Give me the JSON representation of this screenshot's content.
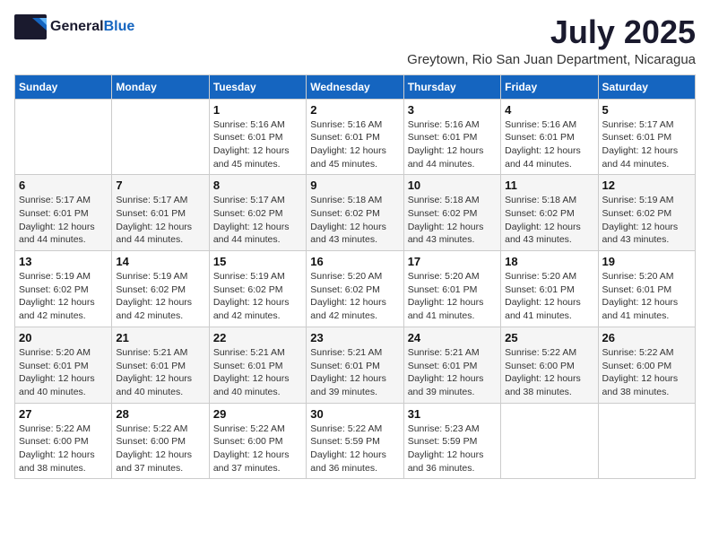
{
  "logo": {
    "general": "General",
    "blue": "Blue"
  },
  "title": {
    "month": "July 2025",
    "subtitle": "Greytown, Rio San Juan Department, Nicaragua"
  },
  "calendar": {
    "headers": [
      "Sunday",
      "Monday",
      "Tuesday",
      "Wednesday",
      "Thursday",
      "Friday",
      "Saturday"
    ],
    "weeks": [
      [
        {
          "day": "",
          "info": ""
        },
        {
          "day": "",
          "info": ""
        },
        {
          "day": "1",
          "info": "Sunrise: 5:16 AM\nSunset: 6:01 PM\nDaylight: 12 hours and 45 minutes."
        },
        {
          "day": "2",
          "info": "Sunrise: 5:16 AM\nSunset: 6:01 PM\nDaylight: 12 hours and 45 minutes."
        },
        {
          "day": "3",
          "info": "Sunrise: 5:16 AM\nSunset: 6:01 PM\nDaylight: 12 hours and 44 minutes."
        },
        {
          "day": "4",
          "info": "Sunrise: 5:16 AM\nSunset: 6:01 PM\nDaylight: 12 hours and 44 minutes."
        },
        {
          "day": "5",
          "info": "Sunrise: 5:17 AM\nSunset: 6:01 PM\nDaylight: 12 hours and 44 minutes."
        }
      ],
      [
        {
          "day": "6",
          "info": "Sunrise: 5:17 AM\nSunset: 6:01 PM\nDaylight: 12 hours and 44 minutes."
        },
        {
          "day": "7",
          "info": "Sunrise: 5:17 AM\nSunset: 6:01 PM\nDaylight: 12 hours and 44 minutes."
        },
        {
          "day": "8",
          "info": "Sunrise: 5:17 AM\nSunset: 6:02 PM\nDaylight: 12 hours and 44 minutes."
        },
        {
          "day": "9",
          "info": "Sunrise: 5:18 AM\nSunset: 6:02 PM\nDaylight: 12 hours and 43 minutes."
        },
        {
          "day": "10",
          "info": "Sunrise: 5:18 AM\nSunset: 6:02 PM\nDaylight: 12 hours and 43 minutes."
        },
        {
          "day": "11",
          "info": "Sunrise: 5:18 AM\nSunset: 6:02 PM\nDaylight: 12 hours and 43 minutes."
        },
        {
          "day": "12",
          "info": "Sunrise: 5:19 AM\nSunset: 6:02 PM\nDaylight: 12 hours and 43 minutes."
        }
      ],
      [
        {
          "day": "13",
          "info": "Sunrise: 5:19 AM\nSunset: 6:02 PM\nDaylight: 12 hours and 42 minutes."
        },
        {
          "day": "14",
          "info": "Sunrise: 5:19 AM\nSunset: 6:02 PM\nDaylight: 12 hours and 42 minutes."
        },
        {
          "day": "15",
          "info": "Sunrise: 5:19 AM\nSunset: 6:02 PM\nDaylight: 12 hours and 42 minutes."
        },
        {
          "day": "16",
          "info": "Sunrise: 5:20 AM\nSunset: 6:02 PM\nDaylight: 12 hours and 42 minutes."
        },
        {
          "day": "17",
          "info": "Sunrise: 5:20 AM\nSunset: 6:01 PM\nDaylight: 12 hours and 41 minutes."
        },
        {
          "day": "18",
          "info": "Sunrise: 5:20 AM\nSunset: 6:01 PM\nDaylight: 12 hours and 41 minutes."
        },
        {
          "day": "19",
          "info": "Sunrise: 5:20 AM\nSunset: 6:01 PM\nDaylight: 12 hours and 41 minutes."
        }
      ],
      [
        {
          "day": "20",
          "info": "Sunrise: 5:20 AM\nSunset: 6:01 PM\nDaylight: 12 hours and 40 minutes."
        },
        {
          "day": "21",
          "info": "Sunrise: 5:21 AM\nSunset: 6:01 PM\nDaylight: 12 hours and 40 minutes."
        },
        {
          "day": "22",
          "info": "Sunrise: 5:21 AM\nSunset: 6:01 PM\nDaylight: 12 hours and 40 minutes."
        },
        {
          "day": "23",
          "info": "Sunrise: 5:21 AM\nSunset: 6:01 PM\nDaylight: 12 hours and 39 minutes."
        },
        {
          "day": "24",
          "info": "Sunrise: 5:21 AM\nSunset: 6:01 PM\nDaylight: 12 hours and 39 minutes."
        },
        {
          "day": "25",
          "info": "Sunrise: 5:22 AM\nSunset: 6:00 PM\nDaylight: 12 hours and 38 minutes."
        },
        {
          "day": "26",
          "info": "Sunrise: 5:22 AM\nSunset: 6:00 PM\nDaylight: 12 hours and 38 minutes."
        }
      ],
      [
        {
          "day": "27",
          "info": "Sunrise: 5:22 AM\nSunset: 6:00 PM\nDaylight: 12 hours and 38 minutes."
        },
        {
          "day": "28",
          "info": "Sunrise: 5:22 AM\nSunset: 6:00 PM\nDaylight: 12 hours and 37 minutes."
        },
        {
          "day": "29",
          "info": "Sunrise: 5:22 AM\nSunset: 6:00 PM\nDaylight: 12 hours and 37 minutes."
        },
        {
          "day": "30",
          "info": "Sunrise: 5:22 AM\nSunset: 5:59 PM\nDaylight: 12 hours and 36 minutes."
        },
        {
          "day": "31",
          "info": "Sunrise: 5:23 AM\nSunset: 5:59 PM\nDaylight: 12 hours and 36 minutes."
        },
        {
          "day": "",
          "info": ""
        },
        {
          "day": "",
          "info": ""
        }
      ]
    ]
  }
}
